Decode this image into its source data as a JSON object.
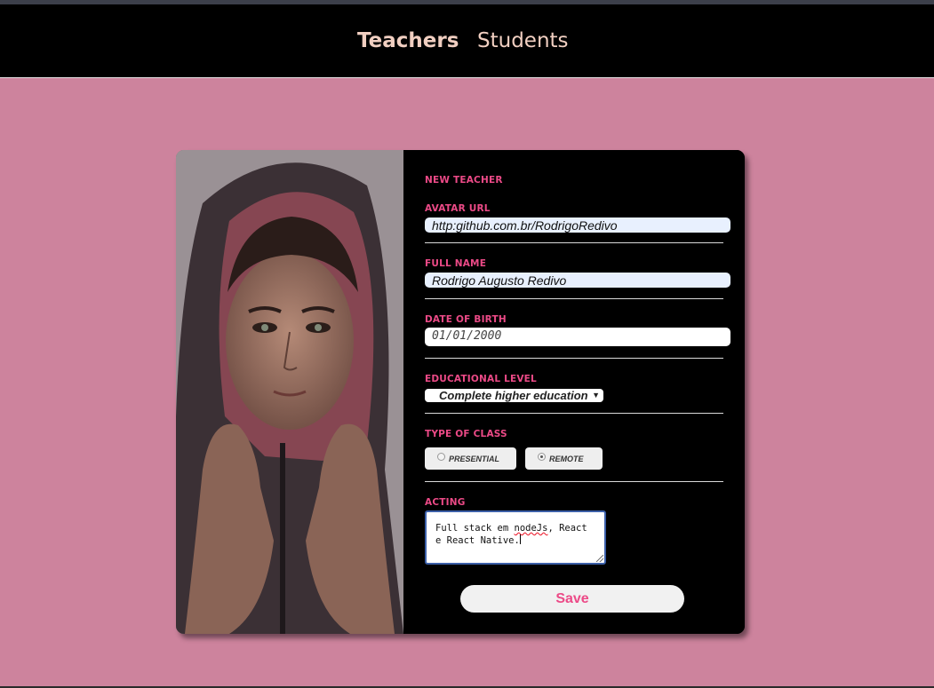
{
  "nav": {
    "teachers_label": "Teachers",
    "students_label": "Students"
  },
  "form": {
    "title": "NEW TEACHER",
    "avatar_url": {
      "label": "AVATAR URL",
      "value": "http:github.com.br/RodrigoRedivo"
    },
    "full_name": {
      "label": "FULL NAME",
      "value": "Rodrigo Augusto Redivo"
    },
    "birth": {
      "label": "DATE OF BIRTH",
      "value": "01/01/2000"
    },
    "education": {
      "label": "EDUCATIONAL LEVEL",
      "selected": "Complete higher education"
    },
    "class_type": {
      "label": "TYPE OF CLASS",
      "options": [
        "PRESENTIAL",
        "REMOTE"
      ],
      "selected": "REMOTE"
    },
    "acting": {
      "label": "ACTING",
      "text_before": "Full stack em ",
      "text_typo": "nodeJs",
      "text_after": ", React e React Native."
    },
    "save_label": "Save"
  },
  "colors": {
    "page_background": "#cd839d",
    "header_background": "#000000",
    "accent": "#ec4a87",
    "nav_text": "#f1cfc1",
    "autofill_background": "#e8f0fe"
  },
  "icons": {
    "select_arrow": "dropdown-arrow-icon",
    "textarea_resize": "resize-grip-icon"
  }
}
